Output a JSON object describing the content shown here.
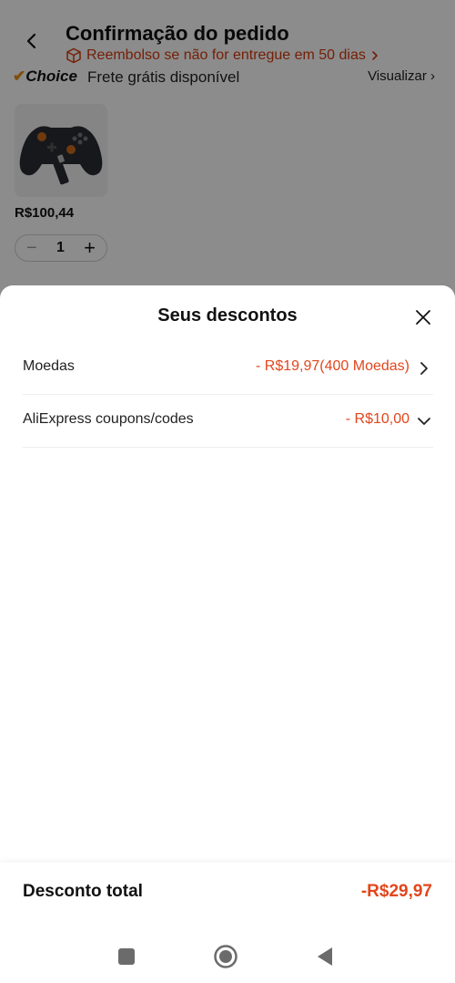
{
  "background_page": {
    "title": "Confirmação do pedido",
    "refund_notice": "Reembolso se não for entregue em 50 dias",
    "choice_logo": "Choice",
    "choice_text": "Frete grátis disponível",
    "view_link": "Visualizar",
    "product": {
      "price": "R$100,44",
      "quantity": "1",
      "minus_symbol": "−",
      "plus_symbol": "+"
    }
  },
  "sheet": {
    "title": "Seus descontos",
    "rows": [
      {
        "label": "Moedas",
        "value": "- R$19,97(400 Moedas)",
        "icon": "chevron-right-icon"
      },
      {
        "label": "AliExpress coupons/codes",
        "value": "- R$10,00",
        "icon": "chevron-down-icon"
      }
    ],
    "total_label": "Desconto total",
    "total_value": "-R$29,97"
  },
  "colors": {
    "accent": "#e2461c",
    "refund_text": "#d43a0e",
    "choice_orange": "#e88f17",
    "overlay": "rgba(0,0,0,0.45)"
  },
  "navigation": {
    "buttons": [
      "recent-apps-icon",
      "home-icon",
      "back-icon"
    ]
  }
}
